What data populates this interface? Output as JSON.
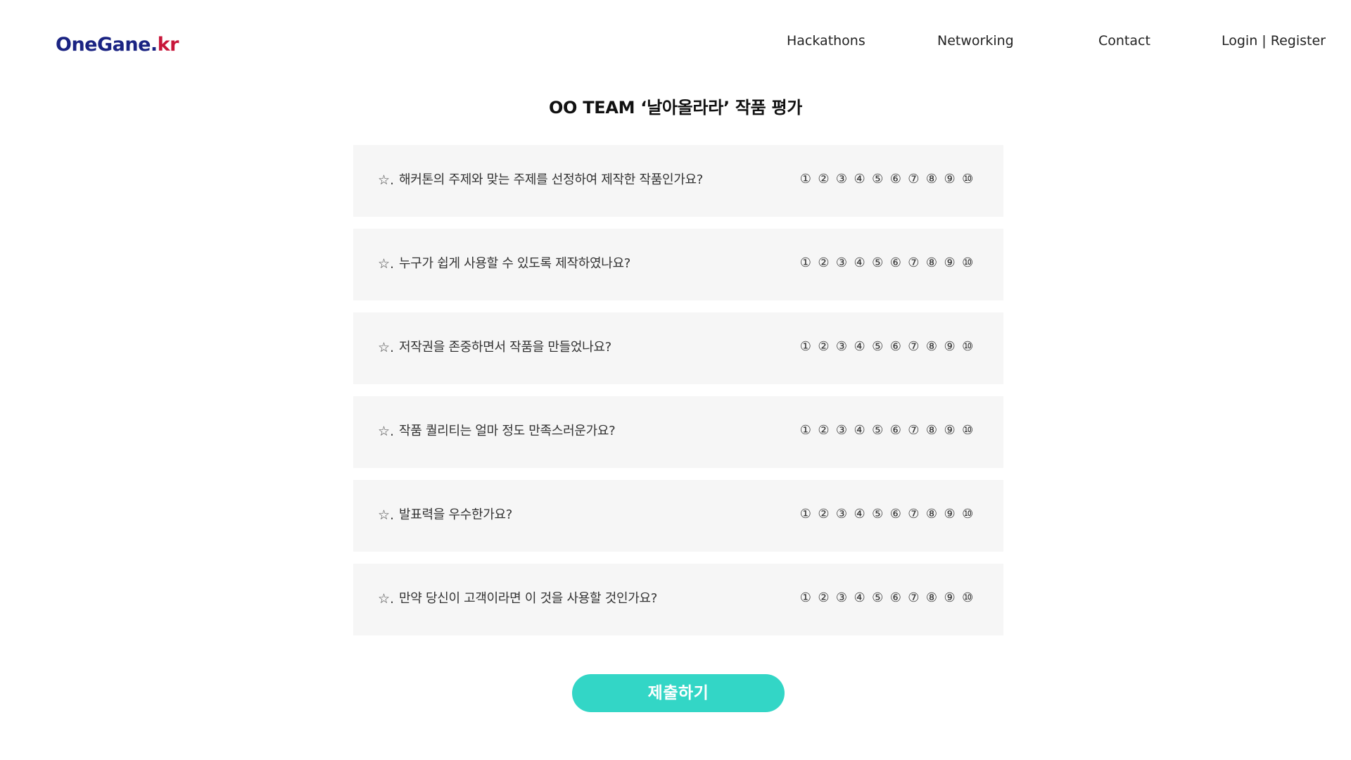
{
  "header": {
    "logo_part1": "OneGane.",
    "logo_part2": "kr",
    "nav": {
      "hackathons": "Hackathons",
      "networking": "Networking",
      "contact": "Contact",
      "login": "Login",
      "separator": " | ",
      "register": "Register"
    },
    "colors": {
      "logo_primary": "#1a2382",
      "logo_accent": "#c8163a"
    }
  },
  "title": "OO TEAM ‘날아올라라’ 작품 평가",
  "questions": [
    {
      "star": "☆.",
      "text": "해커톤의 주제와 맞는 주제를 선정하여 제작한 작품인가요?"
    },
    {
      "star": "☆.",
      "text": "누구가 쉽게 사용할 수 있도록 제작하였나요?"
    },
    {
      "star": "☆.",
      "text": "저작권을 존중하면서 작품을 만들었나요?"
    },
    {
      "star": "☆.",
      "text": "작품 퀄리티는 얼마 정도 만족스러운가요?"
    },
    {
      "star": "☆.",
      "text": "발표력을 우수한가요?"
    },
    {
      "star": "☆.",
      "text": "만약 당신이 고객이라면 이 것을 사용할 것인가요?"
    }
  ],
  "scale": [
    "①",
    "②",
    "③",
    "④",
    "⑤",
    "⑥",
    "⑦",
    "⑧",
    "⑨",
    "⑩"
  ],
  "submit_label": "제출하기",
  "colors": {
    "card_bg": "#f6f6f6",
    "submit_bg": "#33d6c6"
  }
}
